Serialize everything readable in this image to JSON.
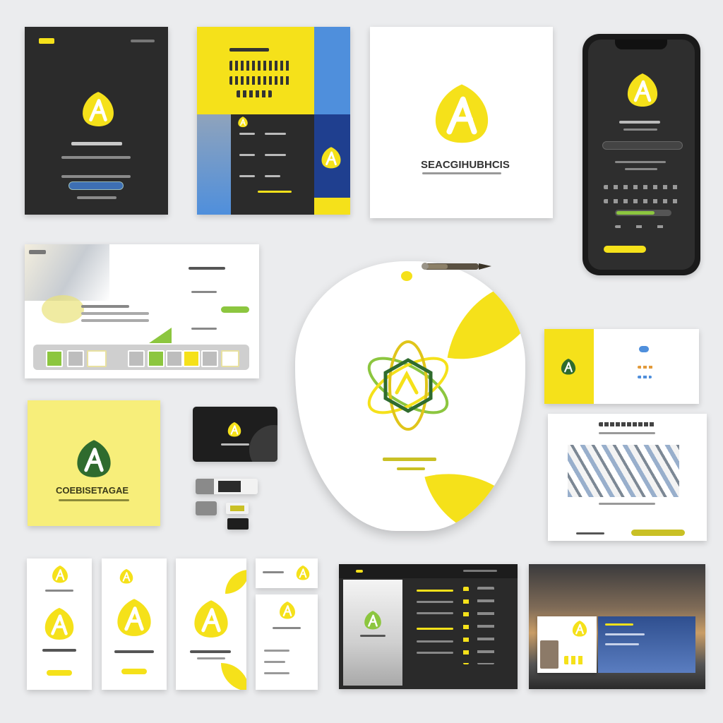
{
  "colors": {
    "yellow": "#f5e11a",
    "lime": "#8cc63f",
    "green": "#2f6b2e",
    "charcoal": "#2b2b2b",
    "blue": "#4f8fdc",
    "navy": "#1f3f8f",
    "white": "#ffffff"
  },
  "brand": {
    "wordmark_white_card": "SEACGIHUBHCIS",
    "wordmark_yellow_card": "COEBISETAGAE"
  },
  "icons": {
    "logo": "leaf-a-logo-icon",
    "emblem": "atom-hexagon-emblem-icon",
    "pen": "pen-icon"
  }
}
